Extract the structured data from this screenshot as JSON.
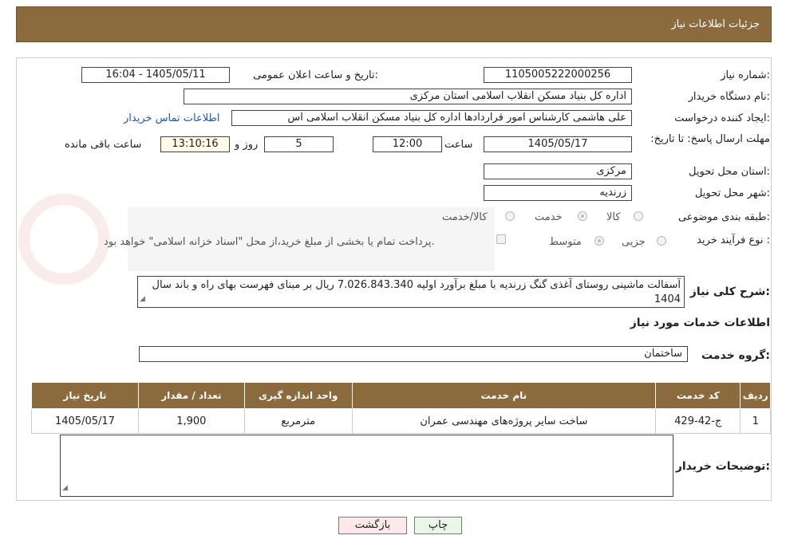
{
  "header": {
    "title": "جزئیات اطلاعات نیاز"
  },
  "form": {
    "need_number": {
      "label": "شماره نیاز:",
      "value": "1105005222000256"
    },
    "announce_datetime": {
      "label": "تاریخ و ساعت اعلان عمومی:",
      "value": "1405/05/11 - 16:04"
    },
    "buyer_org": {
      "label": "نام دستگاه خریدار:",
      "value": "اداره کل بنیاد مسکن انقلاب اسلامی استان مرکزی"
    },
    "requester": {
      "label": "ایجاد کننده درخواست:",
      "value": "علی هاشمی کارشناس امور قراردادها اداره کل بنیاد مسکن انقلاب اسلامی اس",
      "contact_link": "اطلاعات تماس خریدار"
    },
    "deadline": {
      "label": "مهلت ارسال پاسخ: تا تاریخ:",
      "date": "1405/05/17",
      "time_label": "ساعت",
      "time": "12:00",
      "days": "5",
      "days_label": "روز و",
      "remaining": "13:10:16",
      "remaining_label": "ساعت باقی مانده"
    },
    "province": {
      "label": "استان محل تحویل:",
      "value": "مرکزی"
    },
    "city": {
      "label": "شهر محل تحویل:",
      "value": "زرندیه"
    },
    "category": {
      "label": "طبقه بندی موضوعی:",
      "options": [
        "کالا",
        "خدمت",
        "کالا/خدمت"
      ],
      "selected": "خدمت"
    },
    "process": {
      "label": "نوع فرآیند خرید :",
      "options": [
        "جزیی",
        "متوسط"
      ],
      "selected": "متوسط",
      "checkbox_text": "پرداخت تمام یا بخشی از مبلغ خرید،از محل \"اسناد خزانه اسلامی\" خواهد بود."
    },
    "description": {
      "label": "شرح کلی نیاز:",
      "value": "آسفالت ماشینی روستای آغذی گنگ زرندیه با مبلغ برآورد اولیه   7.026.843.340 ریال بر مبنای فهرست بهای راه و باند سال 1404"
    }
  },
  "services": {
    "section_title": "اطلاعات خدمات مورد نیاز",
    "group_label": "گروه خدمت:",
    "group_value": "ساختمان",
    "table": {
      "headers": [
        "ردیف",
        "کد خدمت",
        "نام خدمت",
        "واحد اندازه گیری",
        "تعداد / مقدار",
        "تاریخ نیاز"
      ],
      "rows": [
        [
          "1",
          "ج-42-429",
          "ساخت سایر پروژه‌های مهندسی عمران",
          "مترمربع",
          "1,900",
          "1405/05/17"
        ]
      ]
    }
  },
  "buyer_notes": {
    "label": "توضیحات خریدار:",
    "value": ""
  },
  "buttons": {
    "print": "چاپ",
    "back": "بازگشت"
  },
  "colors": {
    "header_bg": "#8b6b3d",
    "link": "#1a55c9",
    "back_button_bg": "#fde8ea",
    "print_button_bg": "#eaf7e6"
  }
}
